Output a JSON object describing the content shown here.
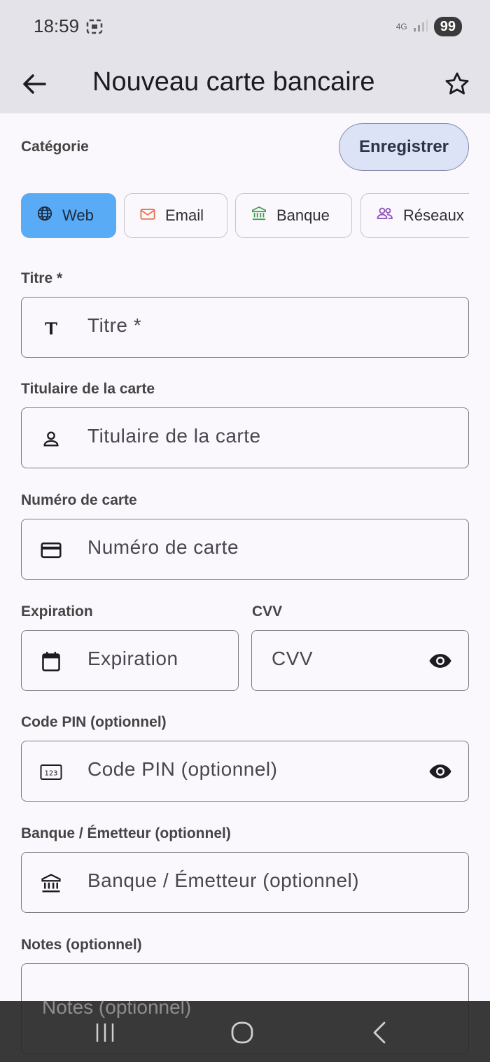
{
  "status": {
    "time": "18:59",
    "network": "4G",
    "battery": "99"
  },
  "appbar": {
    "title": "Nouveau carte bancaire"
  },
  "category": {
    "label": "Catégorie",
    "save_label": "Enregistrer",
    "chips": [
      {
        "label": "Web",
        "icon": "globe-icon",
        "selected": true
      },
      {
        "label": "Email",
        "icon": "mail-icon",
        "selected": false
      },
      {
        "label": "Banque",
        "icon": "bank-icon",
        "selected": false
      },
      {
        "label": "Réseaux s",
        "icon": "people-icon",
        "selected": false
      }
    ]
  },
  "fields": {
    "title": {
      "label": "Titre *",
      "placeholder": "Titre *"
    },
    "holder": {
      "label": "Titulaire de la carte",
      "placeholder": "Titulaire de la carte"
    },
    "number": {
      "label": "Numéro de carte",
      "placeholder": "Numéro de carte"
    },
    "expiration": {
      "label": "Expiration",
      "placeholder": "Expiration"
    },
    "cvv": {
      "label": "CVV",
      "placeholder": "CVV"
    },
    "pin": {
      "label": "Code PIN (optionnel)",
      "placeholder": "Code PIN (optionnel)"
    },
    "bank": {
      "label": "Banque / Émetteur (optionnel)",
      "placeholder": "Banque / Émetteur (optionnel)"
    },
    "notes": {
      "label": "Notes (optionnel)",
      "placeholder": "Notes (optionnel)"
    }
  },
  "colors": {
    "appbar_bg": "#e4e3ea",
    "chip_selected": "#5aabf6",
    "save_button_bg": "#dde3f7"
  }
}
